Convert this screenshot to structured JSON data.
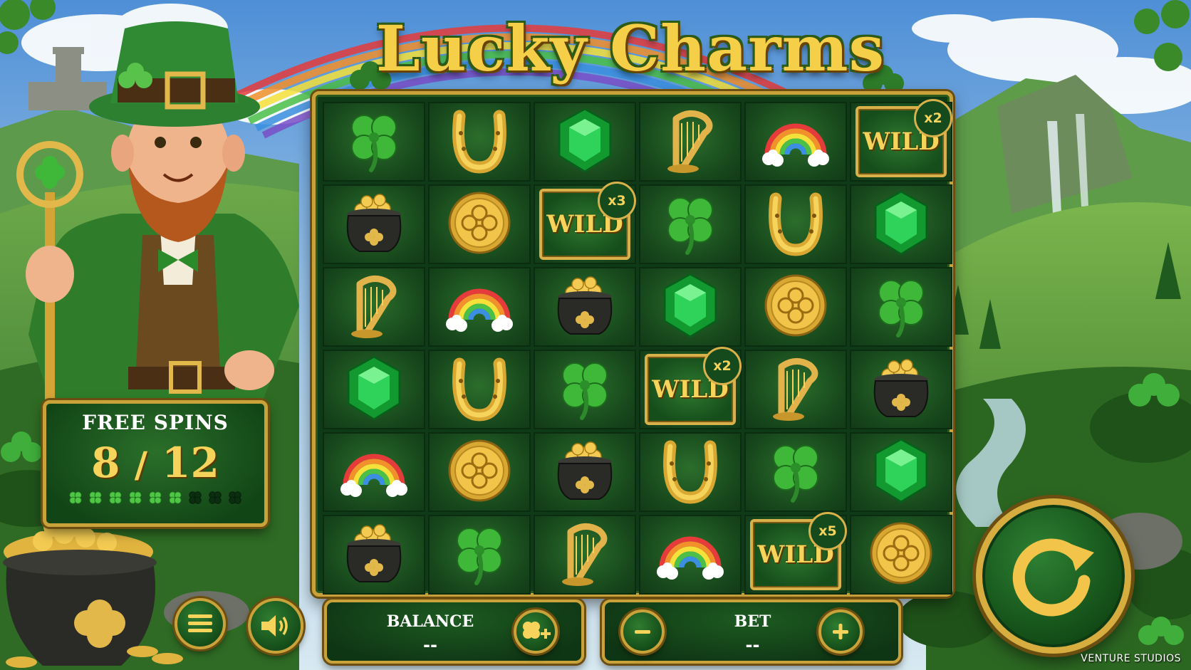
{
  "game": {
    "title": "Lucky Charms",
    "studio": "VENTURE STUDIOS"
  },
  "grid": {
    "rows": [
      [
        "clover",
        "horseshoe",
        "emerald",
        "harp",
        "rainbow",
        "wild"
      ],
      [
        "pot",
        "coin",
        "wild",
        "clover",
        "horseshoe",
        "emerald"
      ],
      [
        "harp",
        "rainbow",
        "pot",
        "emerald",
        "coin",
        "clover"
      ],
      [
        "emerald",
        "horseshoe",
        "clover",
        "wild",
        "harp",
        "pot"
      ],
      [
        "rainbow",
        "coin",
        "pot",
        "horseshoe",
        "clover",
        "emerald"
      ],
      [
        "pot",
        "clover",
        "harp",
        "rainbow",
        "wild",
        "coin"
      ]
    ],
    "wild_label": "WILD",
    "wilds": [
      {
        "row": 0,
        "col": 5,
        "multiplier": "x2"
      },
      {
        "row": 1,
        "col": 2,
        "multiplier": "x3"
      },
      {
        "row": 3,
        "col": 3,
        "multiplier": "x2"
      },
      {
        "row": 5,
        "col": 4,
        "multiplier": "x5"
      }
    ]
  },
  "free_spins": {
    "label": "FREE SPINS",
    "current": "8",
    "separator": "/",
    "total": "12",
    "used": 6,
    "pips": 9
  },
  "balance": {
    "label": "BALANCE",
    "value": "--"
  },
  "bet": {
    "label": "BET",
    "value": "--"
  },
  "icons": {
    "menu": "menu-icon",
    "sound": "speaker-icon",
    "add_funds": "clover-plus-icon",
    "bet_decrease": "minus-icon",
    "bet_increase": "plus-icon",
    "spin": "spin-arrow-icon"
  },
  "colors": {
    "gold": "#c9a23a",
    "gold_text": "#f6d35a",
    "board_green": "#123b16",
    "clover_green": "#3fb83a",
    "emerald": "#1aa33a"
  }
}
